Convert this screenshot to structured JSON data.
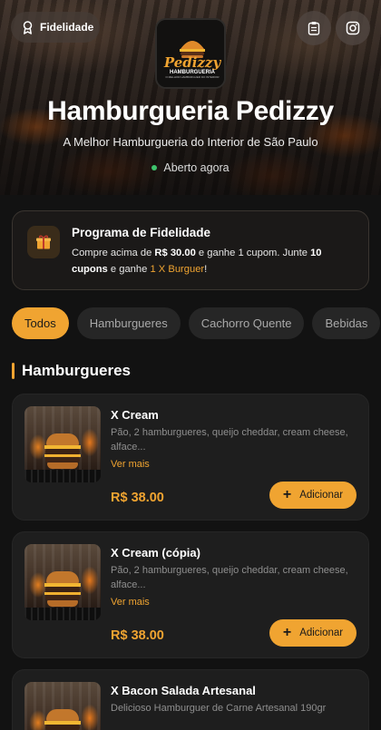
{
  "header": {
    "loyalty_button": "Fidelidade",
    "logo_lines": [
      "Pedizzy",
      "HAMBURGUERIA",
      "O MELHOR HAMBURGUER DO INTERIOR"
    ],
    "title": "Hamburgueria Pedizzy",
    "subtitle": "A Melhor Hamburgueria do Interior de São Paulo",
    "status": "Aberto agora",
    "icons": [
      "ribbon-icon",
      "clipboard-icon",
      "instagram-icon"
    ]
  },
  "loyalty": {
    "title": "Programa de Fidelidade",
    "t1": "Compre acima de ",
    "amount": "R$ 30.00",
    "t2": " e ganhe 1 cupom. Junte ",
    "coupons": "10",
    "t3": "cupons",
    "t4": " e ganhe ",
    "reward": "1 X Burguer",
    "t5": "!"
  },
  "tabs": [
    {
      "label": "Todos",
      "active": true
    },
    {
      "label": "Hamburgueres",
      "active": false
    },
    {
      "label": "Cachorro Quente",
      "active": false
    },
    {
      "label": "Bebidas",
      "active": false
    }
  ],
  "section": {
    "title": "Hamburgueres"
  },
  "products": [
    {
      "name": "X Cream",
      "desc": "Pão, 2 hamburgueres, queijo cheddar, cream cheese, alface...",
      "more": "Ver mais",
      "price": "R$ 38.00",
      "add": "Adicionar"
    },
    {
      "name": "X Cream (cópia)",
      "desc": "Pão, 2 hamburgueres, queijo cheddar, cream cheese, alface...",
      "more": "Ver mais",
      "price": "R$ 38.00",
      "add": "Adicionar"
    },
    {
      "name": "X Bacon Salada Artesanal",
      "desc": "Delicioso Hamburguer de Carne Artesanal 190gr"
    }
  ],
  "colors": {
    "accent": "#f0a431",
    "background": "#121212",
    "card": "#1e1e1e",
    "open": "#3ec46d"
  }
}
